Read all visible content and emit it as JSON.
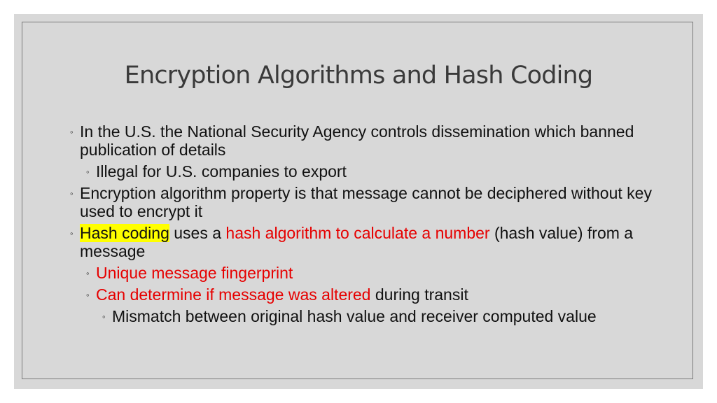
{
  "slide": {
    "title": "Encryption Algorithms and Hash Coding",
    "bullet_glyph": "◦",
    "items": [
      {
        "level": 1,
        "text": "In the U.S. the National Security Agency controls dissemination which banned publication of details"
      },
      {
        "level": 2,
        "text": "Illegal for U.S. companies to export"
      },
      {
        "level": 1,
        "text": "Encryption algorithm property is that message cannot be deciphered without key used to encrypt it"
      },
      {
        "level": 1,
        "segments": [
          {
            "text": "Hash coding",
            "style": "highlight"
          },
          {
            "text": " uses a ",
            "style": "normal"
          },
          {
            "text": "hash algorithm to calculate a number",
            "style": "red"
          },
          {
            "text": " (hash value) from a message",
            "style": "normal"
          }
        ]
      },
      {
        "level": 2,
        "segments": [
          {
            "text": "Unique message fingerprint",
            "style": "red"
          }
        ]
      },
      {
        "level": 2,
        "segments": [
          {
            "text": "Can determine if message was altered",
            "style": "red"
          },
          {
            "text": " during transit",
            "style": "normal"
          }
        ]
      },
      {
        "level": 3,
        "text": "Mismatch between original hash value and receiver computed value"
      }
    ]
  },
  "colors": {
    "emphasis": "#e60000",
    "highlight": "#ffff00",
    "background": "#d8d8d8"
  }
}
